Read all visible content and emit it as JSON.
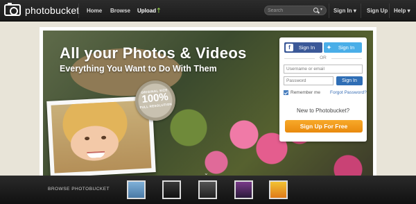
{
  "header": {
    "logo_text": "photobucket",
    "nav": {
      "home": "Home",
      "browse": "Browse",
      "upload": "Upload"
    },
    "search_placeholder": "Search",
    "signin": "Sign In",
    "signup": "Sign Up",
    "help": "Help"
  },
  "hero": {
    "title": "All your Photos & Videos",
    "subtitle": "Everything You Want to Do With Them",
    "badge": {
      "top": "ORIGINAL SIZE",
      "num": "100%",
      "bottom": "FULL RESOLUTION"
    }
  },
  "signin_box": {
    "facebook_label": "Sign In",
    "twitter_label": "Sign In",
    "or": "OR",
    "username_placeholder": "Username or email",
    "password_placeholder": "Password",
    "signin_button": "Sign In",
    "remember": "Remember me",
    "forgot": "Forgot Password?",
    "new_to": "New to Photobucket?",
    "signup_button": "Sign Up For Free"
  },
  "footer": {
    "browse_label": "BROWSE PHOTOBUCKET"
  },
  "colors": {
    "facebook": "#3b5998",
    "twitter": "#4aaee8",
    "signup": "#f39c1e",
    "signin": "#2f6eb5"
  }
}
